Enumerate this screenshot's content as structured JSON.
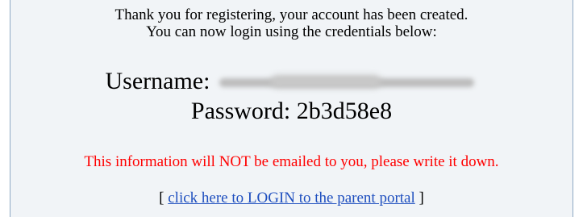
{
  "message": {
    "line1": "Thank you for registering, your account has been created.",
    "line2": "You can now login using the credentials below:"
  },
  "credentials": {
    "username_label": "Username:",
    "password_label": "Password:",
    "password_value": "2b3d58e8"
  },
  "warning": {
    "text": "This information will NOT be emailed to you, please write it down.",
    "color": "#ff0000"
  },
  "login": {
    "open_bracket": "[ ",
    "link_text": "click here to LOGIN to the parent portal",
    "close_bracket": " ]",
    "link_color": "#1f4fbf"
  }
}
